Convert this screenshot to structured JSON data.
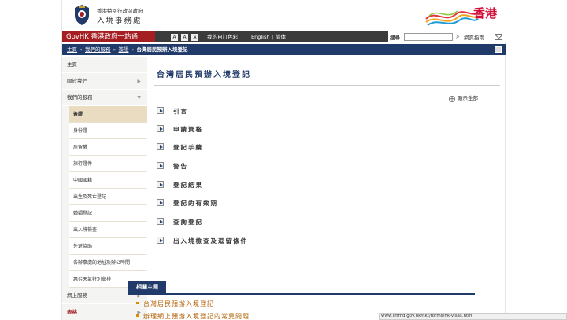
{
  "header": {
    "department_line1": "香港特別行政區政府",
    "department_line2": "入境事務處",
    "brand_text": "香港"
  },
  "govbar": {
    "govhk_label": "GovHK 香港政府一站通",
    "font_small": "A",
    "font_medium": "A",
    "font_large": "A",
    "color_label": "我的自訂色彩",
    "lang_english": "English",
    "lang_simplified": "简体",
    "search_label": "搜尋",
    "search_value": "",
    "sitemap_label": "網頁指南"
  },
  "breadcrumb": {
    "home": "主頁",
    "services": "我們的服務",
    "visas": "簽證",
    "current": "台灣居民預辦入境登記",
    "separator": "»"
  },
  "sidebar": {
    "items": [
      {
        "label": "主頁"
      },
      {
        "label": "關於我們",
        "arrow": "▶"
      },
      {
        "label": "我們的服務",
        "arrow": "▼"
      }
    ],
    "sub_items": [
      {
        "label": "簽證"
      },
      {
        "label": "身份證"
      },
      {
        "label": "居留權"
      },
      {
        "label": "旅行證件"
      },
      {
        "label": "中國國籍"
      },
      {
        "label": "出生及死亡登記"
      },
      {
        "label": "婚姻登記"
      },
      {
        "label": "出入境檢查"
      },
      {
        "label": "外遊協助"
      },
      {
        "label": "各辦事處的地址及辦公時間"
      },
      {
        "label": "惡劣天氣特別安排"
      }
    ],
    "bottom_items": [
      {
        "label": "網上服務",
        "arrow": "▶"
      },
      {
        "label": "表格",
        "arrow": "▶"
      }
    ]
  },
  "content": {
    "title": "台灣居民預辦入境登記",
    "expand_all": "顯示全部",
    "sections": [
      {
        "label": "引言"
      },
      {
        "label": "申請資格"
      },
      {
        "label": "登記手續"
      },
      {
        "label": "警告"
      },
      {
        "label": "登記結果"
      },
      {
        "label": "登記的有效期"
      },
      {
        "label": "查詢登記"
      },
      {
        "label": "出入境檢查及逗留條件"
      }
    ]
  },
  "related": {
    "tab_label": "相關主題",
    "links": [
      {
        "label": "台灣居民預辦入境登記"
      },
      {
        "label": "辦理網上預辦入境登記的常見問題"
      }
    ]
  },
  "status_bar": {
    "url": "www.immd.gov.hk/hkt/forms/hk-visas.html"
  },
  "colors": {
    "govhk_red": "#a41e22",
    "navy": "#203a6a",
    "link_orange": "#b25c00"
  }
}
